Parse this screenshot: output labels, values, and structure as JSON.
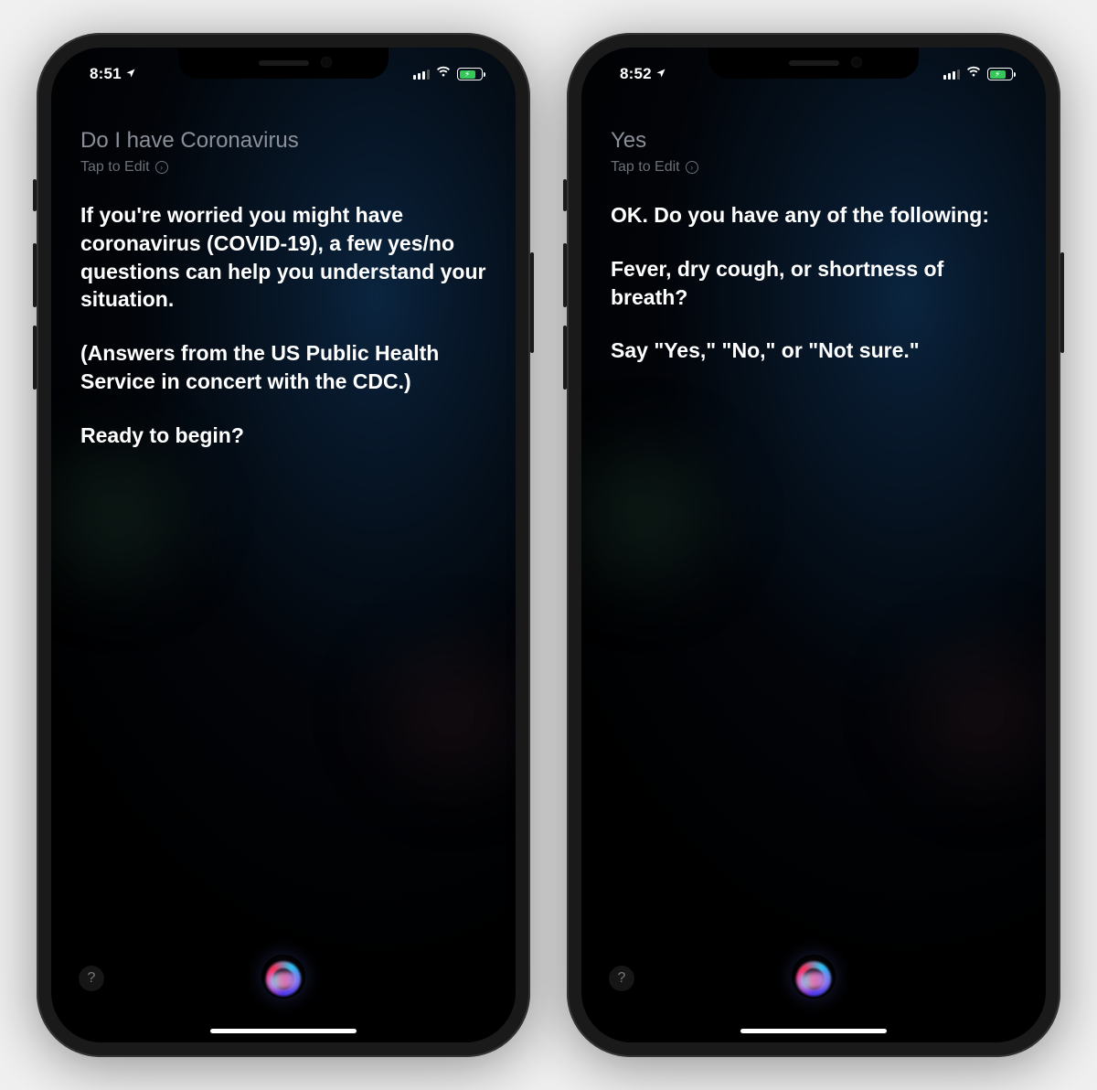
{
  "phones": [
    {
      "status": {
        "time": "8:51",
        "location_active": true
      },
      "query": "Do I have Coronavirus",
      "tap_to_edit": "Tap to Edit",
      "response": {
        "p1": "If you're worried you might have coronavirus (COVID-19), a few yes/no questions can help you understand your situation.",
        "p2": "(Answers from the US Public Health Service in concert with the CDC.)",
        "p3": "Ready to begin?"
      },
      "help_label": "?"
    },
    {
      "status": {
        "time": "8:52",
        "location_active": true
      },
      "query": "Yes",
      "tap_to_edit": "Tap to Edit",
      "response": {
        "p1": "OK. Do you have any of the following:",
        "p2": "Fever, dry cough, or shortness of breath?",
        "p3": "Say \"Yes,\" \"No,\" or \"Not sure.\""
      },
      "help_label": "?"
    }
  ]
}
